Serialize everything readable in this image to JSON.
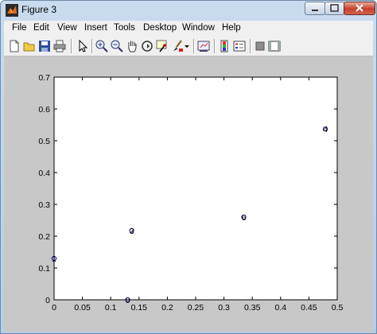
{
  "window": {
    "title": "Figure 3",
    "colors": {
      "titlebar": "#c5d9ee",
      "figure_bg": "#c8c8c8",
      "marker": "#00008b"
    }
  },
  "menu": [
    "File",
    "Edit",
    "View",
    "Insert",
    "Tools",
    "Desktop",
    "Window",
    "Help"
  ],
  "toolbar": [
    "new-figure-icon",
    "open-file-icon",
    "save-icon",
    "print-icon",
    "edit-plot-arrow-icon",
    "zoom-in-icon",
    "zoom-out-icon",
    "pan-hand-icon",
    "rotate-3d-icon",
    "data-cursor-icon",
    "brush-icon",
    "brush-dropdown-icon",
    "link-plot-icon",
    "insert-colorbar-icon",
    "insert-legend-icon",
    "hide-plot-tools-icon",
    "show-plot-tools-icon"
  ],
  "chart_data": {
    "type": "scatter",
    "title": "",
    "xlabel": "",
    "ylabel": "",
    "xlim": [
      0,
      0.5
    ],
    "ylim": [
      0,
      0.7
    ],
    "grid": false,
    "x_ticks": [
      0,
      0.05,
      0.1,
      0.15,
      0.2,
      0.25,
      0.3,
      0.35,
      0.4,
      0.45,
      0.5
    ],
    "x_tick_labels": [
      "0",
      "0.05",
      "0.1",
      "0.15",
      "0.2",
      "0.25",
      "0.3",
      "0.35",
      "0.4",
      "0.45",
      "0.5"
    ],
    "y_ticks": [
      0,
      0.1,
      0.2,
      0.3,
      0.4,
      0.5,
      0.6,
      0.7
    ],
    "y_tick_labels": [
      "0",
      "0.1",
      "0.2",
      "0.3",
      "0.4",
      "0.5",
      "0.6",
      "0.7"
    ],
    "points": [
      {
        "label": "1",
        "x": 0.0,
        "y": 0.13
      },
      {
        "label": "0",
        "x": 0.13,
        "y": 0.0
      },
      {
        "label": "3",
        "x": 0.137,
        "y": 0.218
      },
      {
        "label": "6",
        "x": 0.335,
        "y": 0.26
      },
      {
        "label": "4",
        "x": 0.479,
        "y": 0.537
      }
    ]
  }
}
